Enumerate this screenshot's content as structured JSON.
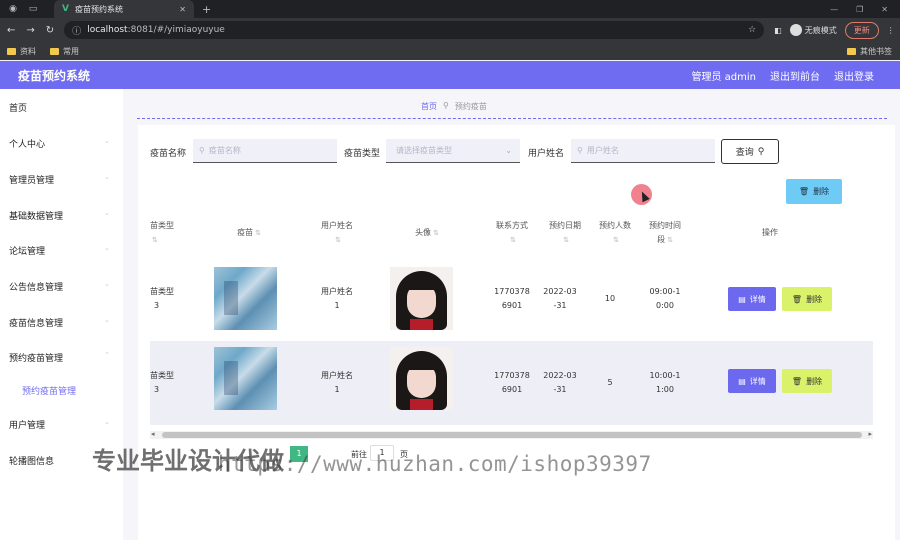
{
  "browser": {
    "tab_title": "疫苗预约系统",
    "url_host": "localhost",
    "url_rest": ":8081/#/yimiaoyuyue",
    "incognito_label": "无痕模式",
    "update_label": "更新",
    "bookmarks": [
      "资料",
      "常用"
    ],
    "other_bookmarks": "其他书签"
  },
  "header": {
    "brand": "疫苗预约系统",
    "user": "管理员 admin",
    "back_front": "退出到前台",
    "logout": "退出登录"
  },
  "sidebar": {
    "items": [
      "首页",
      "个人中心",
      "管理员管理",
      "基础数据管理",
      "论坛管理",
      "公告信息管理",
      "疫苗信息管理",
      "预约疫苗管理",
      "预约疫苗管理",
      "用户管理",
      "轮播图信息"
    ]
  },
  "breadcrumb": {
    "home": "首页",
    "current": "预约疫苗"
  },
  "search": {
    "vaccine_name_label": "疫苗名称",
    "vaccine_name_placeholder": "疫苗名称",
    "vaccine_type_label": "疫苗类型",
    "vaccine_type_placeholder": "请选择疫苗类型",
    "user_name_label": "用户姓名",
    "user_name_placeholder": "用户姓名",
    "query_button": "查询"
  },
  "toolbar": {
    "delete_label": "删除"
  },
  "table": {
    "headers": {
      "type_line1": "苗类型",
      "vaccine": "疫苗",
      "user_name": "用户姓名",
      "avatar": "头像",
      "phone": "联系方式",
      "date": "预约日期",
      "count": "预约人数",
      "time_line1": "预约时间",
      "time_line2": "段",
      "actions": "操作"
    },
    "rows": [
      {
        "type_a": "苗类型",
        "type_b": "3",
        "user_a": "用户姓名",
        "user_b": "1",
        "phone_a": "1770378",
        "phone_b": "6901",
        "date_a": "2022-03",
        "date_b": "-31",
        "count": "10",
        "time_a": "09:00-1",
        "time_b": "0:00",
        "detail": "详情",
        "delete": "删除"
      },
      {
        "type_a": "苗类型",
        "type_b": "3",
        "user_a": "用户姓名",
        "user_b": "1",
        "phone_a": "1770378",
        "phone_b": "6901",
        "date_a": "2022-03",
        "date_b": "-31",
        "count": "5",
        "time_a": "10:00-1",
        "time_b": "1:00",
        "detail": "详情",
        "delete": "删除"
      }
    ]
  },
  "pager": {
    "active": "1",
    "goto": "前往",
    "page_value": "1",
    "page_unit": "页"
  },
  "watermark": {
    "cn": "专业毕业设计代做",
    "url": "https://www.huzhan.com/ishop39397"
  }
}
